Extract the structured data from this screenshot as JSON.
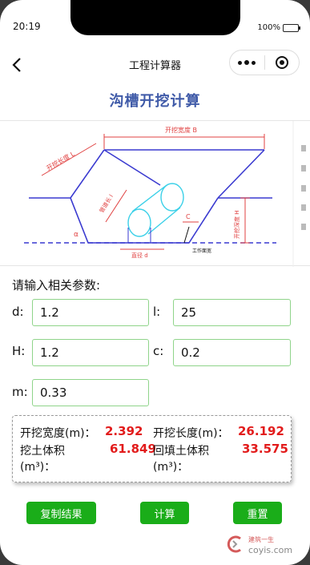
{
  "status_bar": {
    "time": "20:19",
    "battery": "100%"
  },
  "nav": {
    "title": "工程计算器"
  },
  "page": {
    "title": "沟槽开挖计算",
    "prompt": "请输入相关参数:"
  },
  "diagram": {
    "labels": {
      "top_width": "开挖宽度 B",
      "slope_length": "开挖长度 L",
      "pipe_length": "管道长 l",
      "depth": "开挖深度 H",
      "pipe_diameter": "直径 d",
      "work_face": "工作面宽",
      "alpha": "α",
      "c": "C"
    }
  },
  "inputs": {
    "d": {
      "label": "d:",
      "value": "1.2"
    },
    "l": {
      "label": "l:",
      "value": "25"
    },
    "H": {
      "label": "H:",
      "value": "1.2"
    },
    "c": {
      "label": "c:",
      "value": "0.2"
    },
    "m": {
      "label": "m:",
      "value": "0.33"
    }
  },
  "results": {
    "width_label": "开挖宽度(m)：",
    "width_value": "2.392",
    "length_label": "开挖长度(m)：",
    "length_value": "26.192",
    "excavate_label_1": "挖土体积",
    "excavate_label_2": "(m³)：",
    "excavate_value": "61.849",
    "backfill_label_1": "回填土体积",
    "backfill_label_2": "(m³)：",
    "backfill_value": "33.575"
  },
  "buttons": {
    "copy": "复制结果",
    "calc": "计算",
    "reset": "重置"
  },
  "watermark": {
    "top": "建筑一生",
    "bottom": "coyis.com"
  },
  "colors": {
    "accent_green": "#1aad19",
    "result_red": "#e21b1b",
    "title_blue": "#3f5aa8",
    "input_border": "#8fd48a"
  }
}
